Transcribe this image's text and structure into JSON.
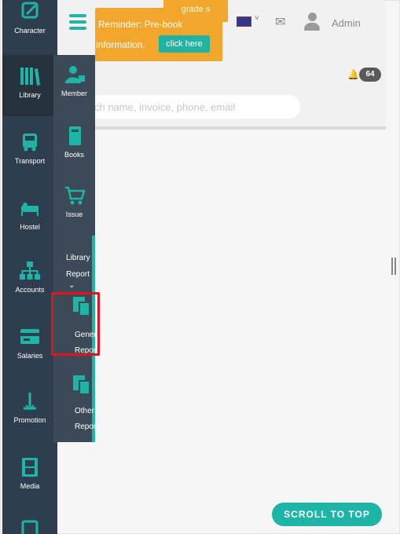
{
  "header": {
    "banner_top": "grade s",
    "banner_line1": "Reminder: Pre-book",
    "banner_line2": "information,",
    "click_here": "click here",
    "flag_caret": "˅",
    "admin_label": "Admin",
    "notification_count": "64",
    "search_placeholder": "ch name, invoice, phone, email"
  },
  "sidebar": {
    "items": [
      {
        "label": "Character",
        "icon": "pencil-icon"
      },
      {
        "label": "Library",
        "icon": "books-icon"
      },
      {
        "label": "Transport",
        "icon": "bus-icon"
      },
      {
        "label": "Hostel",
        "icon": "bed-icon"
      },
      {
        "label": "Accounts",
        "icon": "sitemap-icon"
      },
      {
        "label": "Salaries",
        "icon": "card-icon"
      },
      {
        "label": "Promotion",
        "icon": "arrow-up-icon"
      },
      {
        "label": "Media",
        "icon": "film-icon"
      }
    ]
  },
  "submenu": {
    "items": [
      {
        "label": "Member",
        "icon": "person-icon"
      },
      {
        "label": "Books",
        "icon": "book-icon"
      },
      {
        "label": "Issue",
        "icon": "cart-icon"
      }
    ],
    "library_report_line1": "Library",
    "library_report_line2": "Report",
    "chevron": "⌄",
    "general_report_line1": "General",
    "general_report_line2": "Report",
    "other_report_line1": "Other",
    "other_report_line2": "Report"
  },
  "scroll_top_label": "SCROLL TO TOP",
  "colors": {
    "sidebar": "#2e3e4e",
    "submenu": "#3c4a58",
    "accent": "#1fb5a6",
    "banner": "#f2a72c",
    "highlight": "#e3141e"
  }
}
